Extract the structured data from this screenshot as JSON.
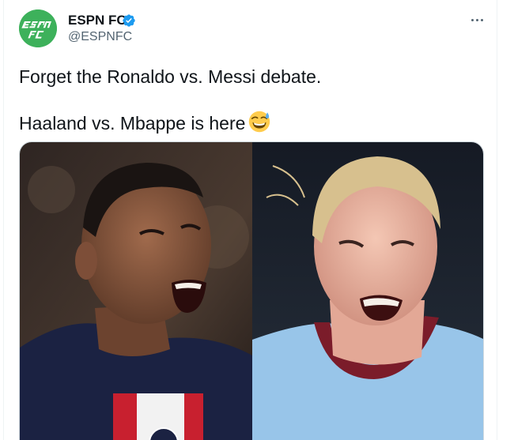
{
  "tweet": {
    "display_name": "ESPN FC",
    "handle": "@ESPNFC",
    "verified": true,
    "avatar_logo_text": "ESPN FC",
    "text_line_1": "Forget the Ronaldo vs. Messi debate.",
    "text_line_2": "Haaland vs. Mbappe is here",
    "emoji": "grinning-face-with-sweat"
  },
  "colors": {
    "accent_blue": "#1d9bf0",
    "avatar_green": "#3db15b",
    "secondary_text": "#536471"
  },
  "icons": {
    "verified": "verified-badge-icon",
    "more": "more-dots-icon"
  }
}
